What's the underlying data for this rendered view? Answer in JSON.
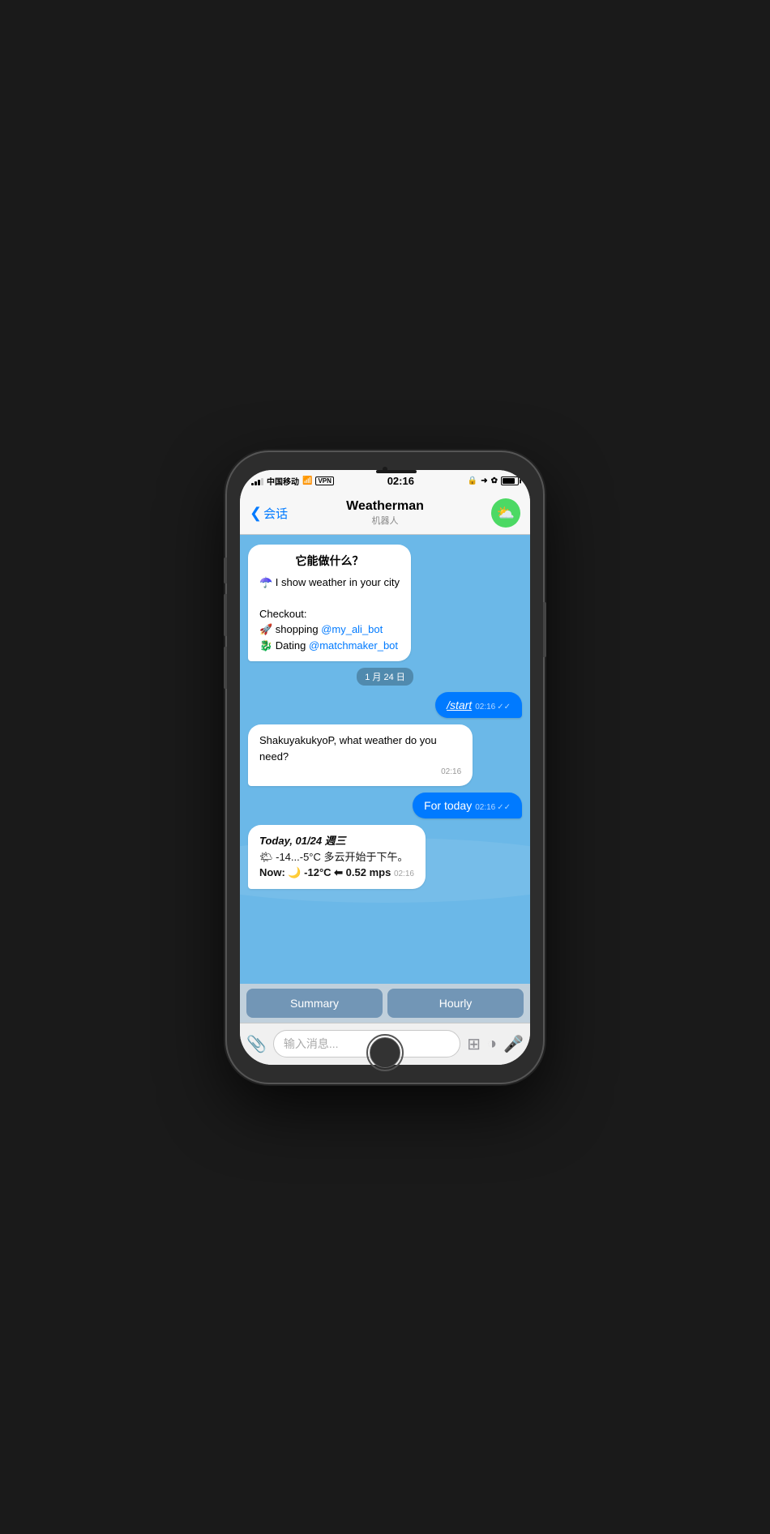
{
  "status_bar": {
    "carrier": "中国移动",
    "wifi": "WiFi",
    "vpn": "VPN",
    "time": "02:16",
    "battery_label": "Battery"
  },
  "nav": {
    "back_label": "会话",
    "title": "Weatherman",
    "subtitle": "机器人"
  },
  "messages": [
    {
      "type": "bot",
      "heading": "它能做什么？",
      "lines": [
        "☂️ I show weather in your city",
        "",
        "Checkout:",
        "🚀 shopping @my_ali_bot",
        "🐉 Dating @matchmaker_bot"
      ],
      "links": [
        "@my_ali_bot",
        "@matchmaker_bot"
      ]
    },
    {
      "type": "date",
      "label": "1 月 24 日"
    },
    {
      "type": "user",
      "text": "/start",
      "time": "02:16",
      "double_check": true
    },
    {
      "type": "bot",
      "text": "ShakuyakukyoP, what weather do you need?",
      "time": "02:16"
    },
    {
      "type": "user",
      "text": "For today",
      "time": "02:16",
      "double_check": true
    },
    {
      "type": "bot_weather",
      "line1": "Today, 01/24 週三",
      "line2": "🌤 -14...-5°C 多云开始于下午。",
      "line3": "Now: 🌙 -12°C ⬅ 0.52 mps",
      "time": "02:16"
    }
  ],
  "quick_replies": {
    "summary_label": "Summary",
    "hourly_label": "Hourly"
  },
  "input": {
    "placeholder": "输入消息..."
  }
}
